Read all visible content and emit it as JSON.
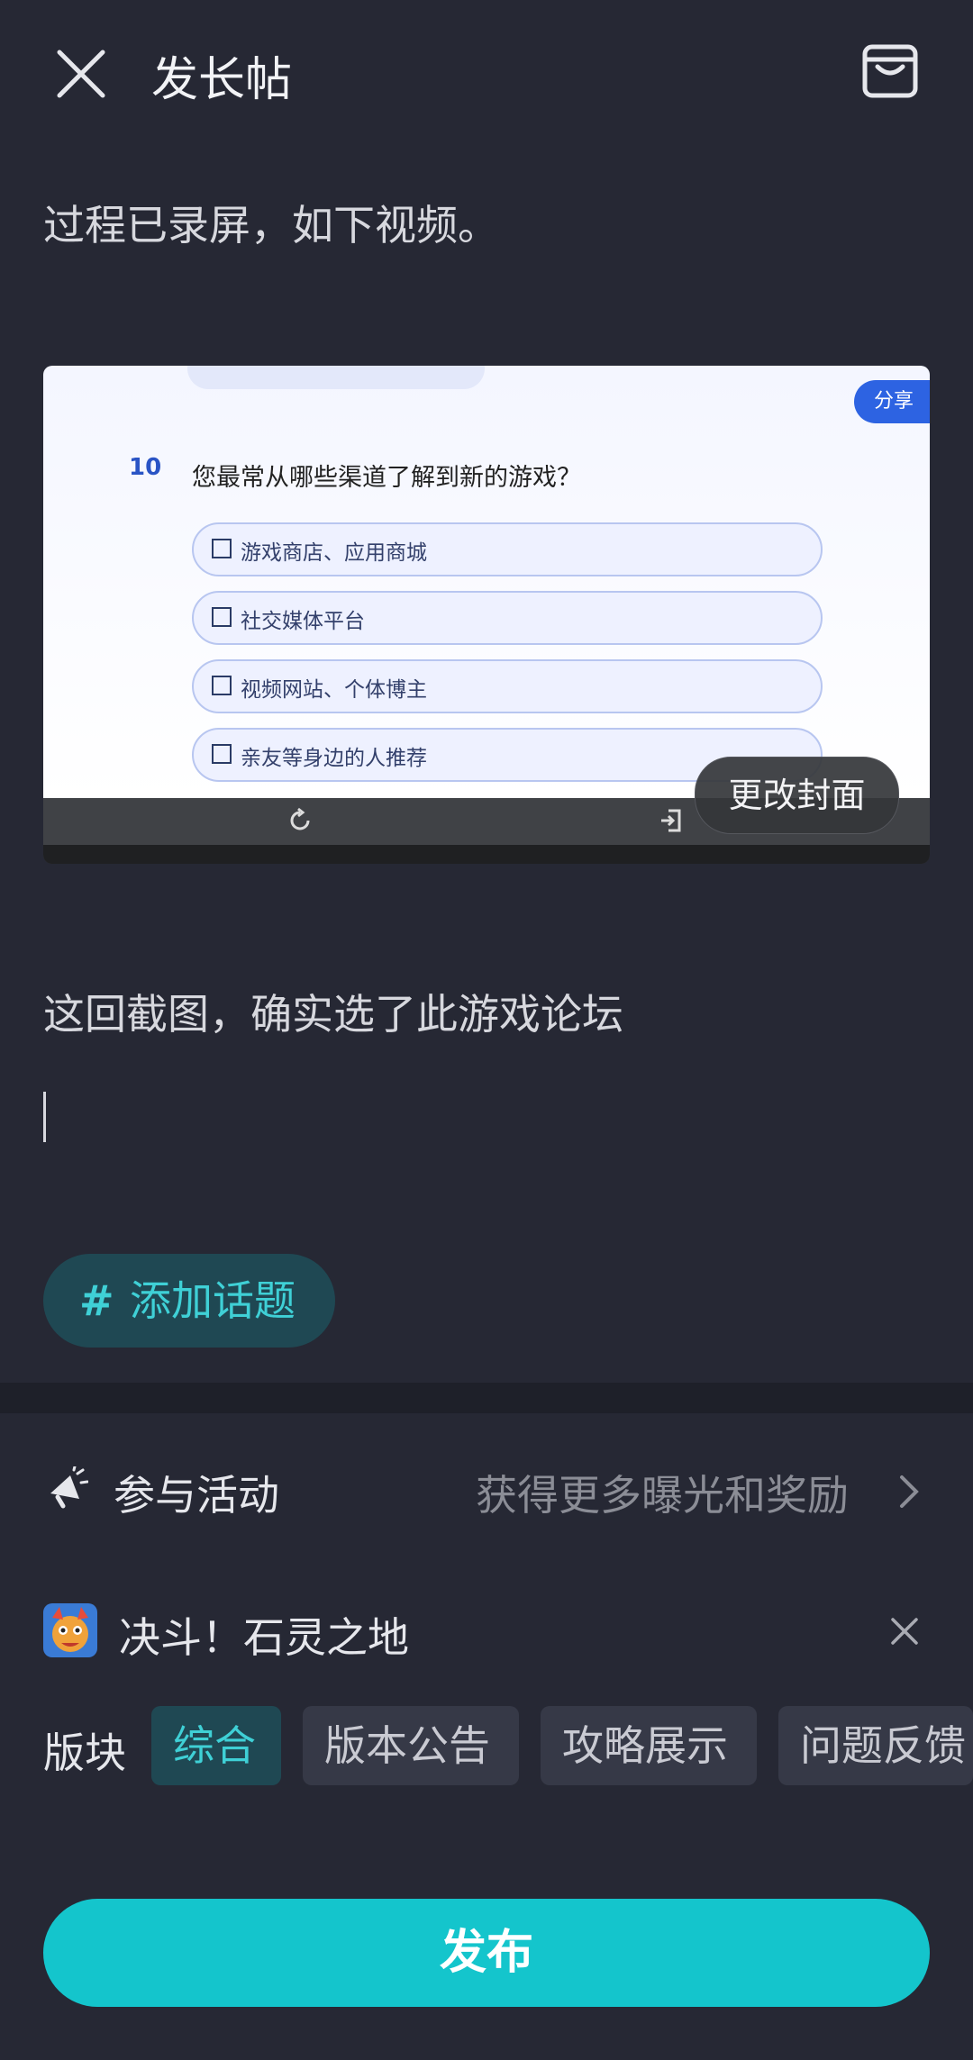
{
  "header": {
    "title": "发长帖",
    "close_icon": "close-icon",
    "draft_icon": "draft-box-icon"
  },
  "content": {
    "intro_text": "过程已录屏，如下视频。",
    "video": {
      "cover_button_label": "更改封面",
      "question_number": "10",
      "question_text": "您最常从哪些渠道了解到新的游戏？",
      "options": [
        "游戏商店、应用商城",
        "社交媒体平台",
        "视频网站、个体博主",
        "亲友等身边的人推荐"
      ],
      "share_label": "分享"
    },
    "paragraph_text": "这回截图，确实选了此游戏论坛"
  },
  "topic": {
    "hash": "#",
    "label": "添加话题"
  },
  "activity": {
    "label": "参与活动",
    "hint": "获得更多曝光和奖励"
  },
  "game": {
    "name": "决斗！石灵之地"
  },
  "sections": {
    "label": "版块",
    "items": [
      "综合",
      "版本公告",
      "攻略展示",
      "问题反馈"
    ],
    "selected": "综合"
  },
  "publish_label": "发布",
  "colors": {
    "accent": "#14c5cc",
    "background": "#262834",
    "chip_active_bg": "#1f4853"
  }
}
